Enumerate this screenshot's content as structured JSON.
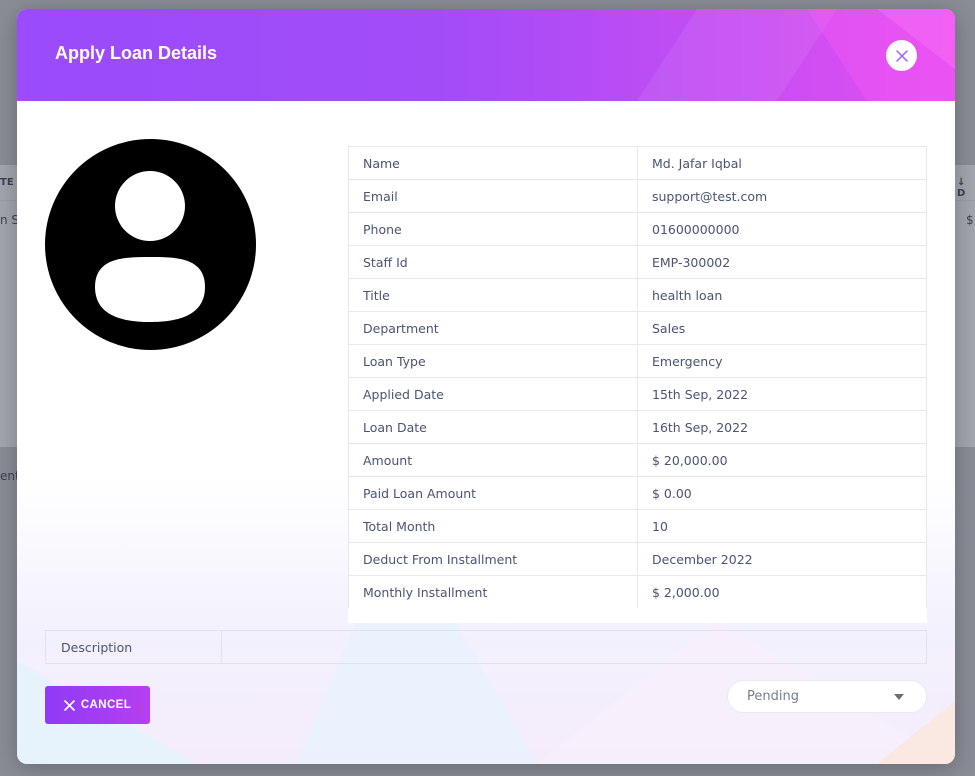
{
  "background": {
    "header_cells": [
      "TE",
      "↓ D"
    ],
    "row_cells": [
      "n S",
      "$"
    ],
    "side_text": "ent"
  },
  "modal": {
    "title": "Apply Loan Details",
    "close_icon": "close-icon",
    "avatar_icon": "user-avatar-icon",
    "details": [
      {
        "label": "Name",
        "value": "Md. Jafar Iqbal"
      },
      {
        "label": "Email",
        "value": "support@test.com"
      },
      {
        "label": "Phone",
        "value": "01600000000"
      },
      {
        "label": "Staff Id",
        "value": "EMP-300002"
      },
      {
        "label": "Title",
        "value": "health loan"
      },
      {
        "label": "Department",
        "value": "Sales"
      },
      {
        "label": "Loan Type",
        "value": "Emergency"
      },
      {
        "label": "Applied Date",
        "value": "15th Sep, 2022"
      },
      {
        "label": "Loan Date",
        "value": "16th Sep, 2022"
      },
      {
        "label": "Amount",
        "value": "$ 20,000.00"
      },
      {
        "label": "Paid Loan Amount",
        "value": "$ 0.00"
      },
      {
        "label": "Total Month",
        "value": "10"
      },
      {
        "label": "Deduct From Installment",
        "value": "December 2022"
      },
      {
        "label": "Monthly Installment",
        "value": "$ 2,000.00"
      }
    ],
    "description": {
      "label": "Description",
      "value": ""
    },
    "cancel_button": {
      "label": "CANCEL",
      "icon": "x-icon"
    },
    "status_select": {
      "selected": "Pending",
      "icon": "caret-down-icon"
    }
  },
  "colors": {
    "header_start": "#9a4bfb",
    "header_end": "#e14ef1",
    "button_start": "#8f3af7",
    "button_end": "#b73ff0",
    "text": "#4a5373"
  }
}
